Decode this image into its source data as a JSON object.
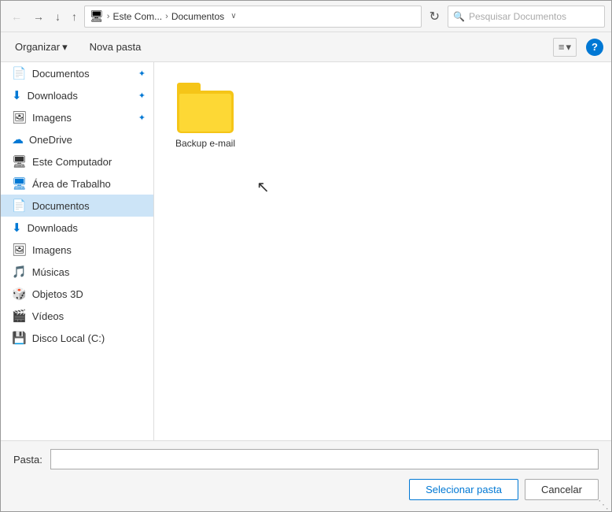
{
  "titlebar": {
    "back_label": "←",
    "forward_label": "→",
    "dropdown_label": "↓",
    "up_label": "↑",
    "crumb_icon": "🖥",
    "crumb_separator": ">",
    "crumb_part1": "Este Com...",
    "crumb_part2": ">",
    "crumb_part3": "Documentos",
    "crumb_dropdown": "∨",
    "refresh_label": "↻",
    "search_placeholder": "Pesquisar Documentos",
    "search_icon": "🔍"
  },
  "toolbar": {
    "organize_label": "Organizar",
    "organize_arrow": "▾",
    "new_folder_label": "Nova pasta",
    "view_icon": "≡",
    "view_arrow": "▾",
    "help_label": "?"
  },
  "sidebar": {
    "items": [
      {
        "id": "documentos-quick",
        "icon": "📄",
        "label": "Documentos",
        "pinned": true
      },
      {
        "id": "downloads-quick",
        "icon": "⬇",
        "label": "Downloads",
        "pinned": true,
        "icon_color": "blue"
      },
      {
        "id": "imagens-quick",
        "icon": "🖼",
        "label": "Imagens",
        "pinned": true
      },
      {
        "id": "onedrive",
        "icon": "☁",
        "label": "OneDrive",
        "pinned": false,
        "icon_color": "blue"
      },
      {
        "id": "este-computador",
        "icon": "🖥",
        "label": "Este Computador",
        "pinned": false
      },
      {
        "id": "area-de-trabalho",
        "icon": "🖥",
        "label": "Área de Trabalho",
        "pinned": false,
        "icon_color": "blue"
      },
      {
        "id": "documentos",
        "icon": "📄",
        "label": "Documentos",
        "pinned": false,
        "active": true
      },
      {
        "id": "downloads",
        "icon": "⬇",
        "label": "Downloads",
        "pinned": false,
        "icon_color": "blue"
      },
      {
        "id": "imagens",
        "icon": "🖼",
        "label": "Imagens",
        "pinned": false
      },
      {
        "id": "musicas",
        "icon": "🎵",
        "label": "Músicas",
        "pinned": false
      },
      {
        "id": "objetos-3d",
        "icon": "🎲",
        "label": "Objetos 3D",
        "pinned": false,
        "icon_color": "blue"
      },
      {
        "id": "videos",
        "icon": "🎬",
        "label": "Vídeos",
        "pinned": false
      },
      {
        "id": "disco-local",
        "icon": "💾",
        "label": "Disco Local (C:)",
        "pinned": false,
        "icon_color": "blue"
      }
    ]
  },
  "files": [
    {
      "id": "backup-email",
      "label": "Backup e-mail",
      "type": "folder"
    }
  ],
  "bottom": {
    "pasta_label": "Pasta:",
    "pasta_placeholder": "",
    "select_btn": "Selecionar pasta",
    "cancel_btn": "Cancelar"
  }
}
